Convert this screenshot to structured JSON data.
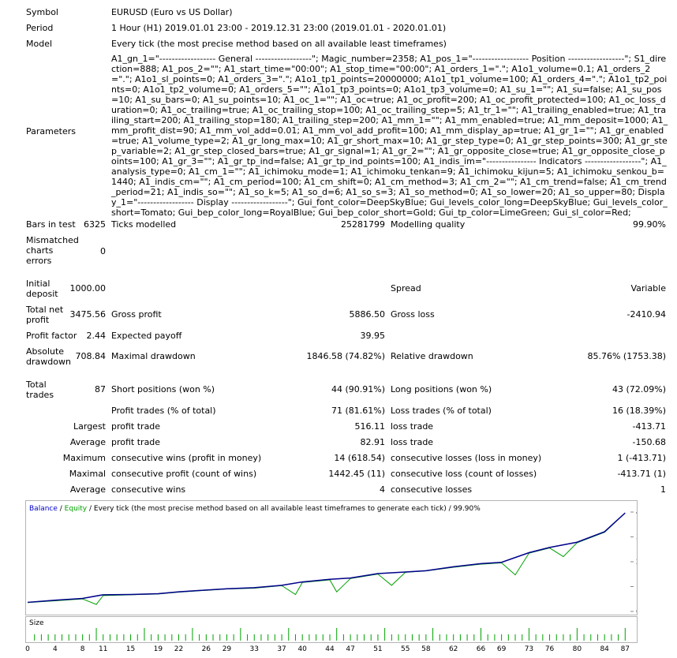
{
  "header": {
    "symbol_label": "Symbol",
    "symbol_value": "EURUSD (Euro vs US Dollar)",
    "period_label": "Period",
    "period_value": "1 Hour (H1) 2019.01.01 23:00 - 2019.12.31 23:00 (2019.01.01 - 2020.01.01)",
    "model_label": "Model",
    "model_value": "Every tick (the most precise method based on all available least timeframes)",
    "parameters_label": "Parameters",
    "parameters_value": "A1_gn_1=\"------------------ General ------------------\"; Magic_number=2358; A1_pos_1=\"------------------ Position ------------------\"; S1_direction=888; A1_pos_2=\"\"; A1_start_time=\"00:00\"; A1_stop_time=\"00:00\"; A1_orders_1=\".\"; A1o1_volume=0.1; A1_orders_2=\".\"; A1o1_sl_points=0; A1_orders_3=\".\"; A1o1_tp1_points=20000000; A1o1_tp1_volume=100; A1_orders_4=\".\"; A1o1_tp2_points=0; A1o1_tp2_volume=0; A1_orders_5=\"\"; A1o1_tp3_points=0; A1o1_tp3_volume=0; A1_su_1=\"\"; A1_su=false; A1_su_pos=10; A1_su_bars=0; A1_su_points=10; A1_oc_1=\"\"; A1_oc=true; A1_oc_profit=200; A1_oc_profit_protected=100; A1_oc_loss_duration=0; A1_oc_trailing=true; A1_oc_trailing_stop=100; A1_oc_trailing_step=5; A1_tr_1=\"\"; A1_trailing_enabled=true; A1_trailing_start=200; A1_trailing_stop=180; A1_trailing_step=200; A1_mm_1=\"\"; A1_mm_enabled=true; A1_mm_deposit=1000; A1_mm_profit_dist=90; A1_mm_vol_add=0.01; A1_mm_vol_add_profit=100; A1_mm_display_ap=true; A1_gr_1=\"\"; A1_gr_enabled=true; A1_volume_type=2; A1_gr_long_max=10; A1_gr_short_max=10; A1_gr_step_type=0; A1_gr_step_points=300; A1_gr_step_variable=2; A1_gr_step_closed_bars=true; A1_gr_signal=1; A1_gr_2=\"\"; A1_gr_opposite_close=true; A1_gr_opposite_close_points=100; A1_gr_3=\"\"; A1_gr_tp_ind=false; A1_gr_tp_ind_points=100; A1_indis_im=\"---------------- Indicators ------------------\"; A1_analysis_type=0; A1_cm_1=\"\"; A1_ichimoku_mode=1; A1_ichimoku_tenkan=9; A1_ichimoku_kijun=5; A1_ichimoku_senkou_b=1440; A1_indis_cm=\"\"; A1_cm_period=100; A1_cm_shift=0; A1_cm_method=3; A1_cm_2=\"\"; A1_cm_trend=false; A1_cm_trend_period=21; A1_indis_so=\"\"; A1_so_k=5; A1_so_d=6; A1_so_s=3; A1_so_method=0; A1_so_lower=20; A1_so_upper=80; Display_1=\"------------------ Display ------------------\"; Gui_font_color=DeepSkyBlue; Gui_levels_color_long=DeepSkyBlue; Gui_levels_color_short=Tomato; Gui_bep_color_long=RoyalBlue; Gui_bep_color_short=Gold; Gui_tp_color=LimeGreen; Gui_sl_color=Red;"
  },
  "stats": {
    "bars_label": "Bars in test",
    "bars_value": "6325",
    "ticks_label": "Ticks modelled",
    "ticks_value": "25281799",
    "quality_label": "Modelling quality",
    "quality_value": "99.90%",
    "mismatch_label": "Mismatched charts errors",
    "mismatch_value": "0",
    "deposit_label": "Initial deposit",
    "deposit_value": "1000.00",
    "spread_label": "Spread",
    "spread_value": "Variable",
    "netprofit_label": "Total net profit",
    "netprofit_value": "3475.56",
    "grossprofit_label": "Gross profit",
    "grossprofit_value": "5886.50",
    "grossloss_label": "Gross loss",
    "grossloss_value": "-2410.94",
    "pf_label": "Profit factor",
    "pf_value": "2.44",
    "payoff_label": "Expected payoff",
    "payoff_value": "39.95",
    "absdd_label": "Absolute drawdown",
    "absdd_value": "708.84",
    "maxdd_label": "Maximal drawdown",
    "maxdd_value": "1846.58 (74.82%)",
    "reldd_label": "Relative drawdown",
    "reldd_value": "85.76% (1753.38)",
    "trades_label": "Total trades",
    "trades_value": "87",
    "short_label": "Short positions (won %)",
    "short_value": "44 (90.91%)",
    "long_label": "Long positions (won %)",
    "long_value": "43 (72.09%)",
    "ptrades_label": "Profit trades (% of total)",
    "ptrades_value": "71 (81.61%)",
    "ltrades_label": "Loss trades (% of total)",
    "ltrades_value": "16 (18.39%)",
    "largest_label": "Largest",
    "lp_label": "profit trade",
    "lp_value": "516.11",
    "ll_label": "loss trade",
    "ll_value": "-413.71",
    "average_label": "Average",
    "ap_label": "profit trade",
    "ap_value": "82.91",
    "al_label": "loss trade",
    "al_value": "-150.68",
    "maximum_label": "Maximum",
    "mcw_label": "consecutive wins (profit in money)",
    "mcw_value": "14 (618.54)",
    "mcl_label": "consecutive losses (loss in money)",
    "mcl_value": "1 (-413.71)",
    "maximal_label": "Maximal",
    "mcp_label": "consecutive profit (count of wins)",
    "mcp_value": "1442.45 (11)",
    "mcloss_label": "consecutive loss (count of losses)",
    "mcloss_value": "-413.71 (1)",
    "avg2_label": "Average",
    "acw_label": "consecutive wins",
    "acw_value": "4",
    "acl_label": "consecutive losses",
    "acl_value": "1"
  },
  "chart_data": {
    "type": "line",
    "caption_balance": "Balance",
    "caption_sep": " / ",
    "caption_equity": "Equity",
    "caption_rest": " / Every tick (the most precise method based on all available least timeframes to generate each tick) / 99.90%",
    "y_ticks": [
      "4454",
      "3503",
      "2552",
      "1602",
      "651"
    ],
    "ylim": [
      651,
      4454
    ],
    "xlim": [
      0,
      88
    ],
    "x_ticks": [
      "0",
      "4",
      "8",
      "11",
      "15",
      "19",
      "22",
      "26",
      "29",
      "33",
      "37",
      "40",
      "44",
      "47",
      "51",
      "55",
      "58",
      "62",
      "66",
      "69",
      "73",
      "76",
      "80",
      "84",
      "87"
    ],
    "colors": {
      "balance": "#00008b",
      "equity": "#00a000",
      "size": "#00a000"
    },
    "series": [
      {
        "name": "Balance",
        "x": [
          0,
          4,
          8,
          11,
          15,
          19,
          22,
          26,
          29,
          33,
          37,
          40,
          44,
          47,
          51,
          55,
          58,
          62,
          66,
          69,
          73,
          76,
          80,
          84,
          87
        ],
        "values": [
          1000,
          1080,
          1150,
          1290,
          1300,
          1330,
          1400,
          1470,
          1520,
          1560,
          1650,
          1780,
          1880,
          1930,
          2100,
          2160,
          2210,
          2360,
          2480,
          2530,
          2900,
          3100,
          3300,
          3700,
          4420
        ]
      },
      {
        "name": "Equity",
        "x": [
          0,
          4,
          8,
          10,
          11,
          15,
          19,
          22,
          26,
          29,
          33,
          37,
          39,
          40,
          44,
          45,
          47,
          51,
          53,
          55,
          58,
          62,
          66,
          69,
          71,
          73,
          76,
          78,
          80,
          84,
          87
        ],
        "values": [
          990,
          1060,
          1130,
          920,
          1260,
          1290,
          1320,
          1390,
          1460,
          1510,
          1540,
          1640,
          1300,
          1760,
          1860,
          1400,
          1910,
          2080,
          1650,
          2150,
          2200,
          2340,
          2460,
          2510,
          2050,
          2880,
          3080,
          2750,
          3280,
          3680,
          4420
        ]
      }
    ],
    "size_label": "Size",
    "size_values": [
      1,
      1,
      1,
      1,
      1,
      1,
      1,
      1,
      1,
      2,
      1,
      1,
      1,
      1,
      1,
      1,
      2,
      1,
      1,
      1,
      1,
      1,
      1,
      2,
      1,
      1,
      1,
      1,
      1,
      1,
      2,
      1,
      1,
      1,
      1,
      1,
      1,
      2,
      1,
      1,
      1,
      1,
      1,
      1,
      2,
      1,
      1,
      1,
      1,
      1,
      1,
      2,
      1,
      1,
      1,
      1,
      1,
      1,
      2,
      1,
      1,
      1,
      1,
      1,
      1,
      2,
      1,
      1,
      1,
      1,
      1,
      1,
      2,
      1,
      1,
      1,
      1,
      1,
      1,
      2,
      1,
      1,
      1,
      1,
      1,
      1,
      2
    ]
  }
}
